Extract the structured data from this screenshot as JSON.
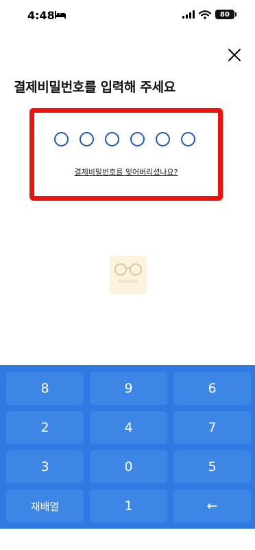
{
  "status_bar": {
    "time": "4:48",
    "battery": "80",
    "icons": [
      "bed-icon",
      "signal-icon",
      "wifi-icon",
      "battery-icon"
    ]
  },
  "header": {
    "close_icon": "close-icon",
    "title": "결제비밀번호를 입력해 주세요"
  },
  "pin": {
    "length": 6,
    "filled": 0,
    "forgot_link": "결제비밀번호를 잊어버리셨나요?",
    "highlight_color": "#f01010",
    "dot_color": "#1f56b8"
  },
  "watermark": {
    "text": "SmartLab",
    "icon": "glasses-icon"
  },
  "keypad": {
    "background": "#2f7ae2",
    "keys": [
      "8",
      "9",
      "6",
      "2",
      "4",
      "7",
      "3",
      "0",
      "5",
      "재배열",
      "1",
      "←"
    ]
  }
}
